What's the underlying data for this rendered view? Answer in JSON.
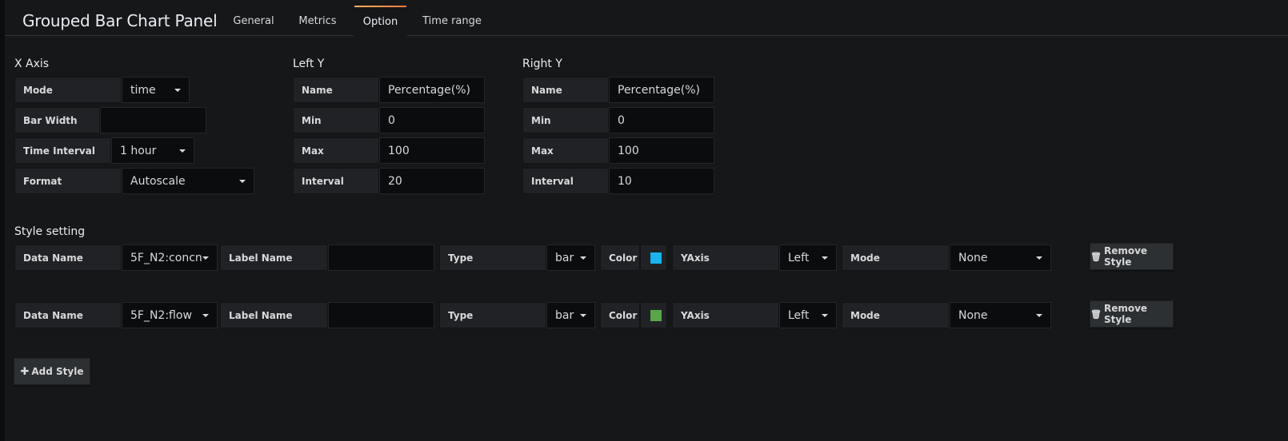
{
  "header": {
    "title": "Grouped Bar Chart Panel",
    "tabs": [
      {
        "label": "General"
      },
      {
        "label": "Metrics"
      },
      {
        "label": "Option"
      },
      {
        "label": "Time range"
      }
    ],
    "active_tab": "Option"
  },
  "x_axis": {
    "title": "X Axis",
    "mode_label": "Mode",
    "mode_value": "time",
    "bar_width_label": "Bar Width",
    "bar_width_value": "",
    "time_interval_label": "Time Interval",
    "time_interval_value": "1 hour",
    "format_label": "Format",
    "format_value": "Autoscale"
  },
  "left_y": {
    "title": "Left Y",
    "name_label": "Name",
    "name_value": "Percentage(%)",
    "min_label": "Min",
    "min_value": "0",
    "max_label": "Max",
    "max_value": "100",
    "interval_label": "Interval",
    "interval_value": "20"
  },
  "right_y": {
    "title": "Right Y",
    "name_label": "Name",
    "name_value": "Percentage(%)",
    "min_label": "Min",
    "min_value": "0",
    "max_label": "Max",
    "max_value": "100",
    "interval_label": "Interval",
    "interval_value": "10"
  },
  "style_setting": {
    "title": "Style setting",
    "rows": [
      {
        "data_name_label": "Data Name",
        "data_name_value": "5F_N2:concn",
        "label_name_label": "Label Name",
        "label_name_value": "",
        "type_label": "Type",
        "type_value": "bar",
        "color_label": "Color",
        "color_value": "#1ab3ee",
        "yaxis_label": "YAxis",
        "yaxis_value": "Left",
        "mode_label": "Mode",
        "mode_value": "None",
        "remove_label": "Remove Style"
      },
      {
        "data_name_label": "Data Name",
        "data_name_value": "5F_N2:flow",
        "label_name_label": "Label Name",
        "label_name_value": "",
        "type_label": "Type",
        "type_value": "bar",
        "color_label": "Color",
        "color_value": "#5aa64b",
        "yaxis_label": "YAxis",
        "yaxis_value": "Left",
        "mode_label": "Mode",
        "mode_value": "None",
        "remove_label": "Remove Style"
      }
    ],
    "add_label": "Add Style"
  },
  "icons": {
    "trash": "trash-icon",
    "plus": "plus-icon"
  }
}
